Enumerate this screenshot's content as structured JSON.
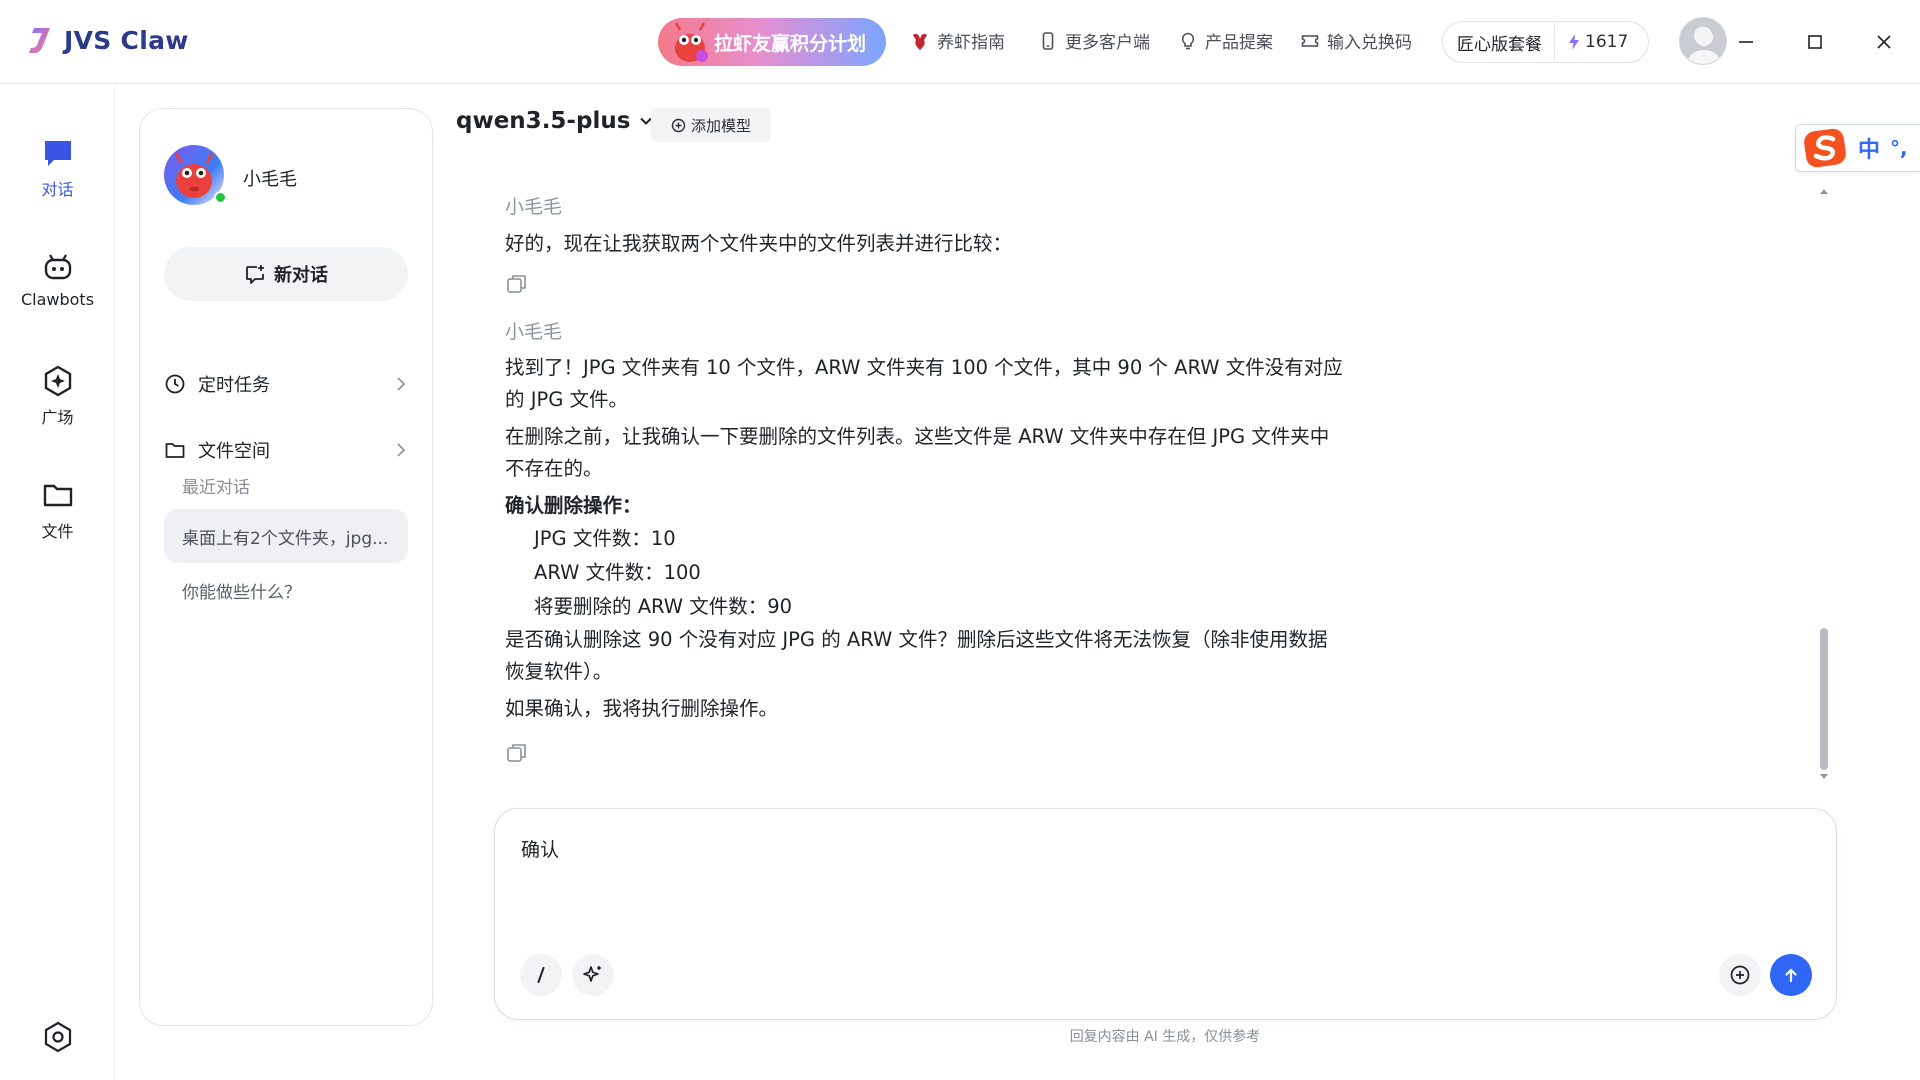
{
  "app": {
    "name": "JVS Claw",
    "promo_label": "拉虾友赢积分计划",
    "nav": [
      {
        "label": "养虾指南",
        "icon": "shrimp-icon"
      },
      {
        "label": "更多客户端",
        "icon": "mobile-icon"
      },
      {
        "label": "产品提案",
        "icon": "lightbulb-icon"
      },
      {
        "label": "输入兑换码",
        "icon": "ticket-icon"
      }
    ],
    "plan_name": "匠心版套餐",
    "credits": "1617",
    "colors": {
      "accent": "#2f66f6",
      "brand": "#2c3a8c",
      "rail_active": "#3a55e6"
    }
  },
  "rail": {
    "items": [
      {
        "label": "对话",
        "icon": "chat-icon",
        "active": true
      },
      {
        "label": "Clawbots",
        "icon": "bot-icon",
        "active": false
      },
      {
        "label": "广场",
        "icon": "plaza-icon",
        "active": false
      },
      {
        "label": "文件",
        "icon": "folder-icon",
        "active": false
      }
    ],
    "settings_icon": "settings-icon"
  },
  "panel": {
    "agent_name": "小毛毛",
    "new_chat_label": "新对话",
    "rows": [
      {
        "label": "定时任务",
        "icon": "clock-icon"
      },
      {
        "label": "文件空间",
        "icon": "folder-icon"
      }
    ],
    "recent_label": "最近对话",
    "recent": [
      {
        "label": "桌面上有2个文件夹，jpg...",
        "active": true
      },
      {
        "label": "你能做些什么？",
        "active": false
      }
    ]
  },
  "chat": {
    "model": "qwen3.5-plus",
    "add_model_label": "添加模型",
    "messages": [
      {
        "sender": "小毛毛",
        "lines": [
          "好的，现在让我获取两个文件夹中的文件列表并进行比较："
        ]
      },
      {
        "sender": "小毛毛",
        "para1": [
          "找到了！JPG 文件夹有 10 个文件，ARW 文件夹有 100 个文件，其中 90 个 ARW 文件没有对应",
          "的 JPG 文件。"
        ],
        "para2": [
          "在删除之前，让我确认一下要删除的文件列表。这些文件是 ARW 文件夹中存在但 JPG 文件夹中",
          "不存在的。"
        ],
        "heading": "确认删除操作：",
        "bullets": [
          "JPG 文件数：10",
          "ARW 文件数：100",
          "将要删除的 ARW 文件数：90"
        ],
        "para3": [
          "是否确认删除这 90 个没有对应 JPG 的 ARW 文件？删除后这些文件将无法恢复（除非使用数据",
          "恢复软件）。"
        ],
        "para4": "如果确认，我将执行删除操作。"
      }
    ],
    "ime": {
      "zh_label": "中",
      "punc_label": "°,"
    },
    "composer": {
      "value": "确认"
    },
    "disclaimer": "回复内容由 AI 生成，仅供参考"
  }
}
